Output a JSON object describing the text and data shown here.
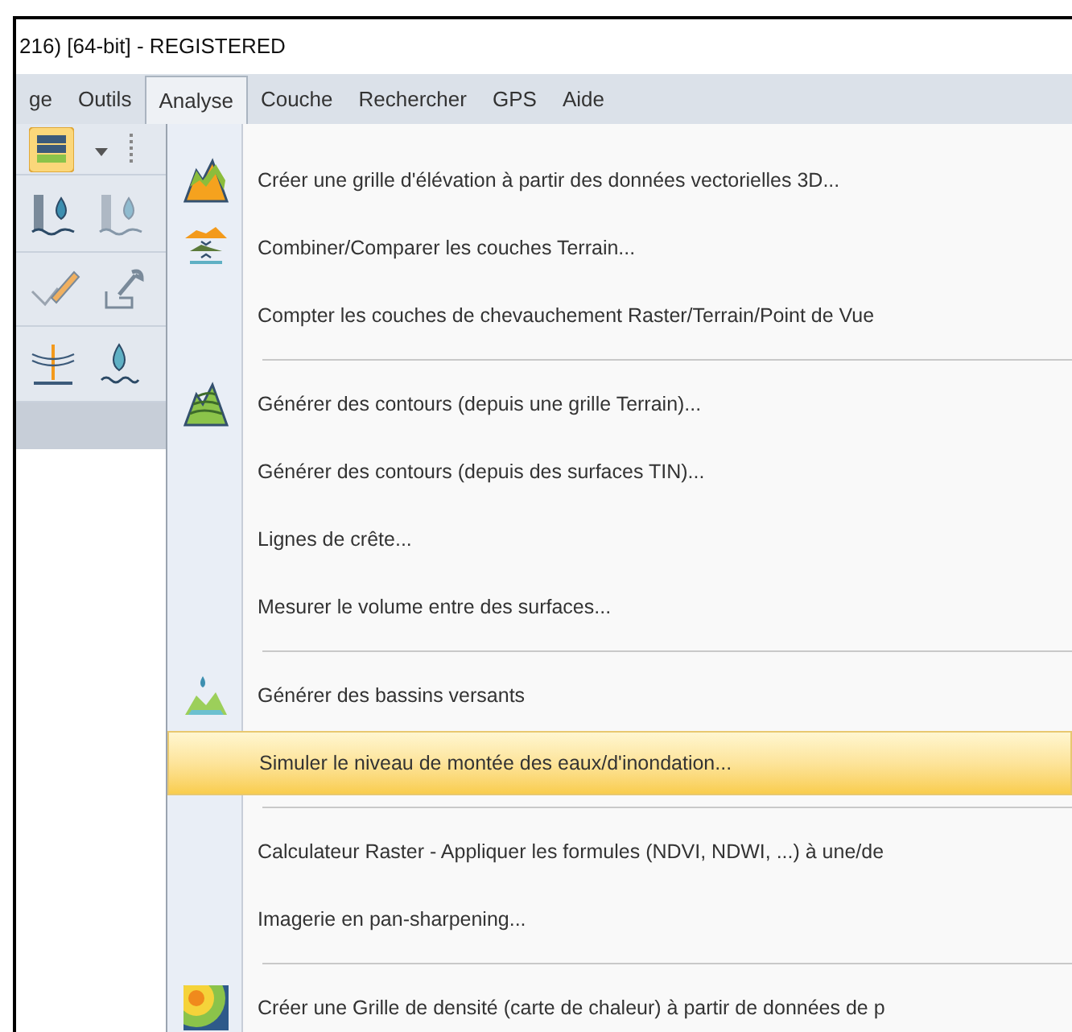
{
  "window": {
    "title": "216) [64-bit] - REGISTERED"
  },
  "menubar": [
    {
      "label": "ge",
      "selected": false
    },
    {
      "label": "Outils",
      "selected": false
    },
    {
      "label": "Analyse",
      "selected": true
    },
    {
      "label": "Couche",
      "selected": false
    },
    {
      "label": "Rechercher",
      "selected": false
    },
    {
      "label": "GPS",
      "selected": false
    },
    {
      "label": "Aide",
      "selected": false
    }
  ],
  "menu": [
    {
      "kind": "elevation",
      "label": "Créer une grille d'élévation à partir des données vectorielles 3D...",
      "selected": false
    },
    {
      "kind": "compare",
      "label": "Combiner/Comparer les couches Terrain...",
      "selected": false
    },
    {
      "kind": "plain",
      "label": "Compter les couches de chevauchement Raster/Terrain/Point de Vue",
      "selected": false
    },
    {
      "kind": "separator"
    },
    {
      "kind": "contours",
      "label": "Générer des contours (depuis une grille Terrain)...",
      "selected": false
    },
    {
      "kind": "plain",
      "label": "Générer des contours (depuis des surfaces TIN)...",
      "selected": false
    },
    {
      "kind": "plain",
      "label": "Lignes de crête...",
      "selected": false
    },
    {
      "kind": "plain",
      "label": "Mesurer le volume entre des surfaces...",
      "selected": false
    },
    {
      "kind": "separator"
    },
    {
      "kind": "watershed",
      "label": "Générer des bassins versants",
      "selected": false
    },
    {
      "kind": "plain",
      "label": "Simuler le niveau de montée des eaux/d'inondation...",
      "selected": true
    },
    {
      "kind": "separator"
    },
    {
      "kind": "plain",
      "label": "Calculateur Raster - Appliquer les formules (NDVI, NDWI, ...) à une/de",
      "selected": false
    },
    {
      "kind": "plain",
      "label": "Imagerie en pan-sharpening...",
      "selected": false
    },
    {
      "kind": "separator"
    },
    {
      "kind": "heatmap",
      "label": "Créer une Grille de densité (carte de chaleur) à partir de données de p",
      "selected": false
    }
  ]
}
